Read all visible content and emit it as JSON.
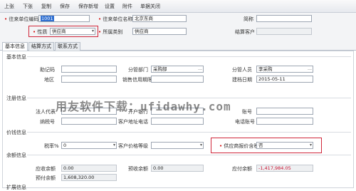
{
  "toolbar": {
    "items": [
      "上张",
      "下张",
      "复制",
      "保存",
      "保存新增",
      "设置",
      "附件",
      "单据关闭"
    ]
  },
  "header": {
    "code_label": "往来单位编码",
    "code_value": "1001",
    "name_label": "往来单位名称",
    "name_value": "北京东商",
    "short_label": "简称",
    "short_value": "",
    "nature_label": "性质",
    "nature_value": "供应商",
    "category_label": "所属类别",
    "category_value": "供应商",
    "settle_label": "结算客户",
    "settle_value": ""
  },
  "tabs": [
    "基本信息",
    "结算方式",
    "联系方式"
  ],
  "sections": {
    "basic": "基本信息",
    "register": "注册信息",
    "price": "价钱信息",
    "balance": "余额信息",
    "extend": "扩展信息"
  },
  "basic": {
    "mnemonic_label": "助记码",
    "mnemonic_value": "",
    "dept_label": "分管部门",
    "dept_value": "采购部",
    "staff_label": "分管人员",
    "staff_value": "李采购",
    "region_label": "地区",
    "region_value": "",
    "sales_cycle_label": "销售信用期限",
    "sales_cycle_value": "",
    "date_label": "建档日期",
    "date_value": "2015-05-11"
  },
  "register": {
    "legal_label": "法人代表",
    "legal_value": "",
    "bank_label": "开户银行",
    "bank_value": "",
    "account_label": "账号",
    "account_value": "",
    "tax_label": "纳税号",
    "tax_value": "",
    "addr_label": "客户地址电话",
    "addr_value": "",
    "phone_label": "电话账号",
    "phone_value": ""
  },
  "price": {
    "taxrate_label": "税率%",
    "taxrate_value": "0",
    "level_label": "客户价格等级",
    "level_value": "",
    "vendor_tax_label": "供应商报价含税",
    "vendor_tax_value": "否"
  },
  "balance": {
    "receivable_label": "应收余额",
    "receivable_value": "0.00",
    "prereceive_label": "预收余额",
    "prereceive_value": "0.00",
    "payable_label": "应付余额",
    "payable_value": "-1,417,984.05",
    "prepay_label": "预付余额",
    "prepay_value": "1,608,320.00"
  },
  "watermark": "用友软件下载：ufidawhy.com"
}
